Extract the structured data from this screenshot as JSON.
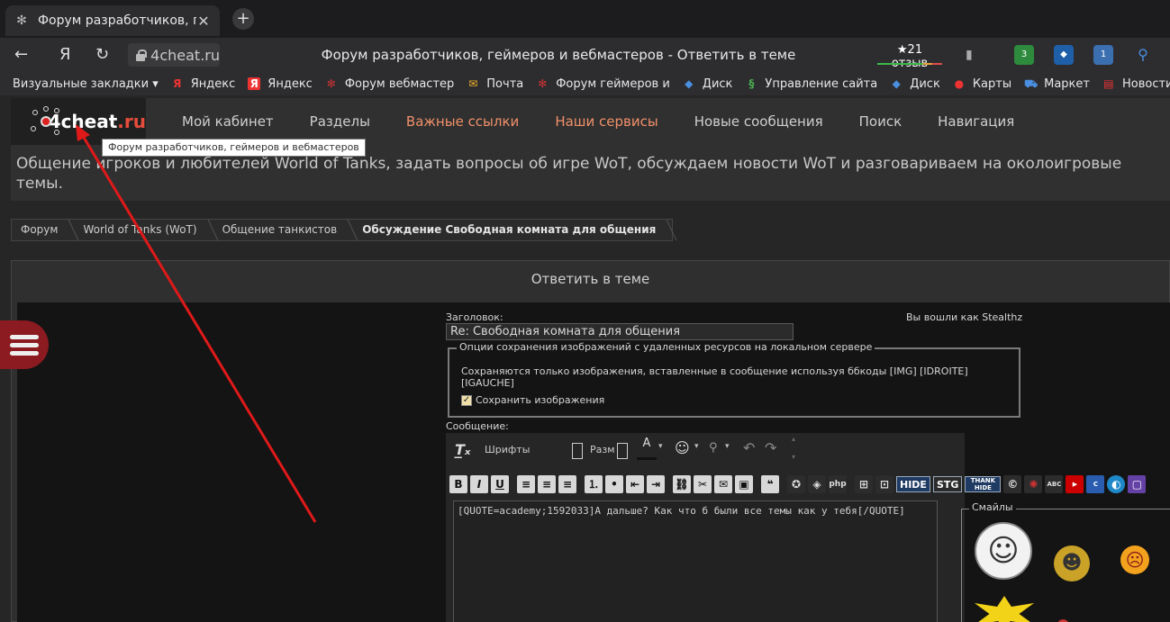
{
  "browser": {
    "tab_title": "Форум разработчиков, гейм",
    "new_tab": "+",
    "url": "4cheat.ru",
    "page_title": "Форум разработчиков, геймеров и вебмастеров - Ответить в теме",
    "reviews": "★21 отзыв",
    "bookmarks": [
      {
        "label": "Визуальные закладки ▾",
        "icon": ""
      },
      {
        "label": "Яндекс",
        "icon": "yandex-icon"
      },
      {
        "label": "Яндекс",
        "icon": "yandex-icon"
      },
      {
        "label": "Форум вебмастер",
        "icon": "forum-icon"
      },
      {
        "label": "Почта",
        "icon": "mail-icon"
      },
      {
        "label": "Форум геймеров и",
        "icon": "forum-icon"
      },
      {
        "label": "Диск",
        "icon": "disk-icon"
      },
      {
        "label": "Управление сайта",
        "icon": "manage-icon"
      },
      {
        "label": "Диск",
        "icon": "disk-icon"
      },
      {
        "label": "Карты",
        "icon": "maps-icon"
      },
      {
        "label": "Маркет",
        "icon": "market-icon"
      },
      {
        "label": "Новости",
        "icon": "news-icon"
      }
    ]
  },
  "site": {
    "logo_text": "4cheat",
    "logo_suffix": ".ru",
    "nav": [
      "Мой кабинет",
      "Разделы",
      "Важные ссылки",
      "Наши сервисы",
      "Новые сообщения",
      "Поиск",
      "Навигация"
    ],
    "tooltip": "Форум разработчиков, геймеров и вебмастеров",
    "description": "Общение игроков и любителей World of Tanks, задать вопросы об игре WoT, обсуждаем новости WoT и разговариваем на околоигровые темы.",
    "breadcrumbs": [
      "Форум",
      "World of Tanks (WoT)",
      "Общение танкистов",
      "Обсуждение Свободная комната для общения"
    ]
  },
  "reply": {
    "heading": "Ответить в теме",
    "subject_label": "Заголовок:",
    "subject_value": "Re: Свободная комната для общения",
    "logged_in": "Вы вошли как Stealthz",
    "images_legend": "Опции сохранения изображений с удаленных ресурсов на локальном сервере",
    "images_text": "Сохраняются только изображения, вставленные в сообщение используя ббкоды [IMG] [IDROITE] [IGAUCHE]",
    "save_images_label": "Сохранить изображения",
    "message_label": "Сообщение:",
    "fonts_label": "Шрифты",
    "size_label": "Разм",
    "tags": [
      "HIDE",
      "STG",
      "THANK HIDE"
    ],
    "message_text": "[QUOTE=academy;1592033]А дальше? Как что б были все темы как у тебя[/QUOTE]",
    "smileys_label": "Смайлы"
  }
}
